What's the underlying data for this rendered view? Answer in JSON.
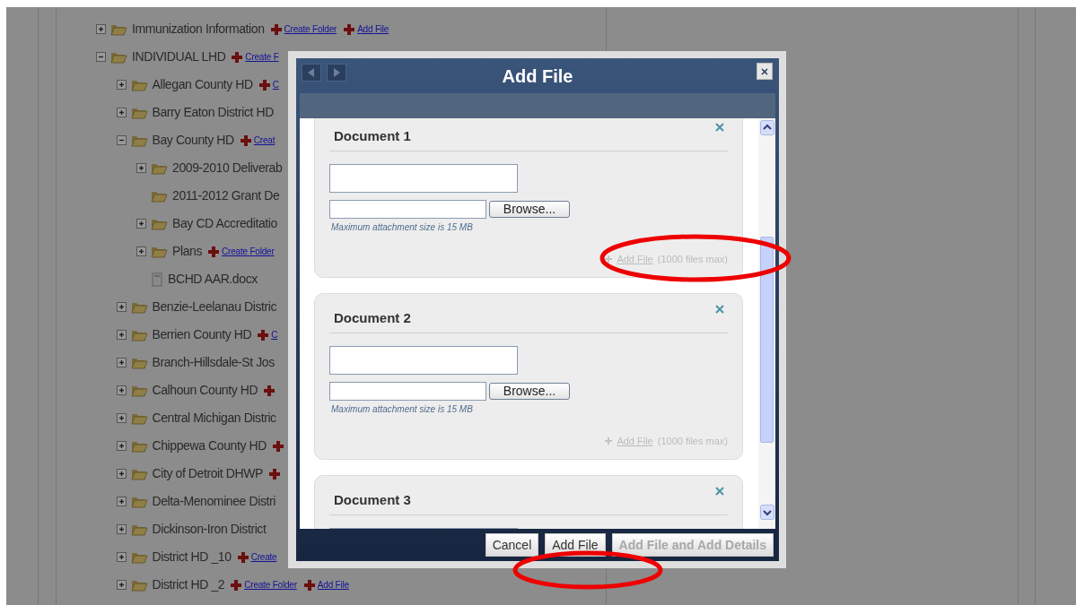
{
  "tree": [
    {
      "kind": "folder",
      "label": "Immunization Information",
      "expanded": false,
      "links": [
        "Create Folder",
        "Add File"
      ]
    },
    {
      "kind": "folder",
      "label": "INDIVIDUAL LHD",
      "expanded": true,
      "links": [
        "Create F"
      ],
      "children": [
        {
          "kind": "folder",
          "label": "Allegan County HD",
          "expanded": false,
          "links": [
            "C"
          ]
        },
        {
          "kind": "folder",
          "label": "Barry Eaton District HD",
          "expanded": false
        },
        {
          "kind": "folder",
          "label": "Bay County HD",
          "expanded": true,
          "links": [
            "Creat"
          ],
          "children": [
            {
              "kind": "folder",
              "label": "2009-2010 Deliverab",
              "expanded": false
            },
            {
              "kind": "folder",
              "label": "2011-2012 Grant De"
            },
            {
              "kind": "folder",
              "label": "Bay CD Accreditatio",
              "expanded": false
            },
            {
              "kind": "folder",
              "label": "Plans",
              "expanded": false,
              "links": [
                "Create Folder"
              ]
            },
            {
              "kind": "file",
              "label": "BCHD AAR.docx"
            }
          ]
        },
        {
          "kind": "folder",
          "label": "Benzie-Leelanau Distric",
          "expanded": false
        },
        {
          "kind": "folder",
          "label": "Berrien County HD",
          "expanded": false,
          "links": [
            "C"
          ]
        },
        {
          "kind": "folder",
          "label": "Branch-Hillsdale-St Jos",
          "expanded": false
        },
        {
          "kind": "folder",
          "label": "Calhoun County HD",
          "expanded": false,
          "extra_plus_icon": true
        },
        {
          "kind": "folder",
          "label": "Central Michigan Distric",
          "expanded": false
        },
        {
          "kind": "folder",
          "label": "Chippewa County HD",
          "expanded": false,
          "extra_plus_icon": true
        },
        {
          "kind": "folder",
          "label": "City of Detroit DHWP",
          "expanded": false,
          "extra_plus_icon": true
        },
        {
          "kind": "folder",
          "label": "Delta-Menominee Distri",
          "expanded": false
        },
        {
          "kind": "folder",
          "label": "Dickinson-Iron District",
          "expanded": false
        },
        {
          "kind": "folder",
          "label": "District HD _10",
          "expanded": false,
          "links": [
            "Create"
          ]
        },
        {
          "kind": "folder",
          "label": "District HD _2",
          "expanded": false,
          "links": [
            "Create Folder",
            "Add File"
          ]
        }
      ]
    }
  ],
  "dialog": {
    "title": "Add File",
    "documents": [
      {
        "title": "Document 1",
        "browse": "Browse...",
        "hint": "Maximum attachment size is 15 MB",
        "add_link": "Add File",
        "add_note": "(1000 files max)"
      },
      {
        "title": "Document 2",
        "browse": "Browse...",
        "hint": "Maximum attachment size is 15 MB",
        "add_link": "Add File",
        "add_note": "(1000 files max)"
      },
      {
        "title": "Document 3"
      }
    ],
    "buttons": [
      {
        "label": "Cancel",
        "disabled": false
      },
      {
        "label": "Add File",
        "disabled": false
      },
      {
        "label": "Add File and Add Details",
        "disabled": true
      }
    ]
  }
}
